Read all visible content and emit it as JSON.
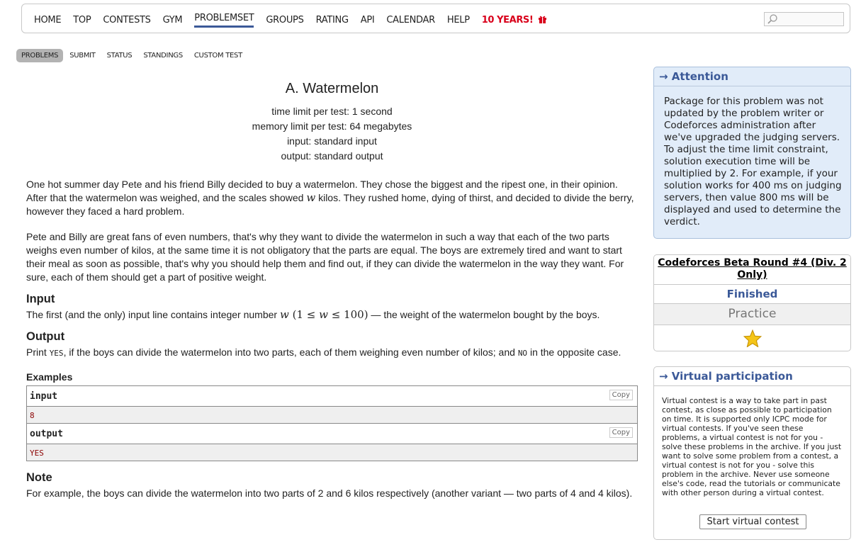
{
  "nav": {
    "items": [
      "HOME",
      "TOP",
      "CONTESTS",
      "GYM",
      "PROBLEMSET",
      "GROUPS",
      "RATING",
      "API",
      "CALENDAR",
      "HELP"
    ],
    "active": "PROBLEMSET",
    "anniversary": "10 YEARS!",
    "search_placeholder": ""
  },
  "submenu": {
    "items": [
      "PROBLEMS",
      "SUBMIT",
      "STATUS",
      "STANDINGS",
      "CUSTOM TEST"
    ],
    "active": "PROBLEMS"
  },
  "problem": {
    "title": "A. Watermelon",
    "time_limit": "time limit per test: 1 second",
    "memory_limit": "memory limit per test: 64 megabytes",
    "input_file": "input: standard input",
    "output_file": "output: standard output",
    "statement_p1_a": "One hot summer day Pete and his friend Billy decided to buy a watermelon. They chose the biggest and the ripest one, in their opinion. After that the watermelon was weighed, and the scales showed ",
    "statement_p1_var": "w",
    "statement_p1_b": " kilos. They rushed home, dying of thirst, and decided to divide the berry, however they faced a hard problem.",
    "statement_p2": "Pete and Billy are great fans of even numbers, that's why they want to divide the watermelon in such a way that each of the two parts weighs even number of kilos, at the same time it is not obligatory that the parts are equal. The boys are extremely tired and want to start their meal as soon as possible, that's why you should help them and find out, if they can divide the watermelon in the way they want. For sure, each of them should get a part of positive weight.",
    "input_title": "Input",
    "input_text_a": "The first (and the only) input line contains integer number ",
    "input_var": "w",
    "input_constraint_open": " (1 ≤ ",
    "input_constraint_var": "w",
    "input_constraint_close": " ≤ 100)",
    "input_text_b": " — the weight of the watermelon bought by the boys.",
    "output_title": "Output",
    "output_text_a": "Print ",
    "output_yes": "YES",
    "output_text_b": ", if the boys can divide the watermelon into two parts, each of them weighing even number of kilos; and ",
    "output_no": "NO",
    "output_text_c": " in the opposite case.",
    "examples_title": "Examples",
    "example_input_label": "input",
    "example_input_value": "8",
    "example_output_label": "output",
    "example_output_value": "YES",
    "copy_label": "Copy",
    "note_title": "Note",
    "note_text": "For example, the boys can divide the watermelon into two parts of 2 and 6 kilos respectively (another variant — two parts of 4 and 4 kilos)."
  },
  "sidebar": {
    "attention_title": "→ Attention",
    "attention_text": "Package for this problem was not updated by the problem writer or Codeforces administration after we've upgraded the judging servers. To adjust the time limit constraint, solution execution time will be multiplied by 2. For example, if your solution works for 400 ms on judging servers, then value 800 ms will be displayed and used to determine the verdict.",
    "contest_name": "Codeforces Beta Round #4 (Div. 2 Only)",
    "contest_status": "Finished",
    "contest_phase": "Practice",
    "virtual_title": "→ Virtual participation",
    "virtual_text": "Virtual contest is a way to take part in past contest, as close as possible to participation on time. It is supported only ICPC mode for virtual contests. If you've seen these problems, a virtual contest is not for you - solve these problems in the archive. If you just want to solve some problem from a contest, a virtual contest is not for you - solve this problem in the archive. Never use someone else's code, read the tutorials or communicate with other person during a virtual contest.",
    "virtual_button": "Start virtual contest"
  },
  "colors": {
    "link_blue": "#3b5998",
    "anniversary_red": "#d9001b",
    "attention_bg": "#e1ecf9",
    "star_fill": "#f5c518"
  },
  "icons": {
    "search": "search-icon",
    "gift": "gift-icon",
    "star": "star-icon"
  }
}
